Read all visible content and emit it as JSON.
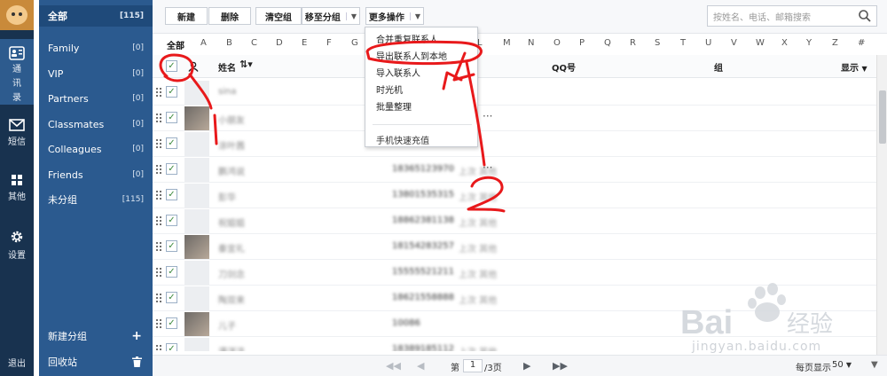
{
  "rail": {
    "contacts_label": "通讯录",
    "sms_label": "短信",
    "other_label": "其他",
    "settings_label": "设置",
    "logout_label": "退出"
  },
  "groups": {
    "items": [
      {
        "label": "全部",
        "count": "[115]"
      },
      {
        "label": "Family",
        "count": "[0]"
      },
      {
        "label": "VIP",
        "count": "[0]"
      },
      {
        "label": "Partners",
        "count": "[0]"
      },
      {
        "label": "Classmates",
        "count": "[0]"
      },
      {
        "label": "Colleagues",
        "count": "[0]"
      },
      {
        "label": "Friends",
        "count": "[0]"
      },
      {
        "label": "未分组",
        "count": "[115]"
      }
    ],
    "new_group_label": "新建分组",
    "recycle_label": "回收站"
  },
  "toolbar": {
    "new_label": "新建",
    "delete_label": "删除",
    "clear_group_label": "清空组",
    "move_group_label": "移至分组",
    "more_label": "更多操作",
    "search_placeholder": "按姓名、电话、邮箱搜索"
  },
  "alphabet": [
    "全部",
    "A",
    "B",
    "C",
    "D",
    "E",
    "F",
    "G",
    "H",
    "I",
    "J",
    "K",
    "L",
    "M",
    "N",
    "O",
    "P",
    "Q",
    "R",
    "S",
    "T",
    "U",
    "V",
    "W",
    "X",
    "Y",
    "Z",
    "#"
  ],
  "table": {
    "col_name": "姓名",
    "col_qq": "QQ号",
    "col_group": "组",
    "col_display": "显示",
    "rows": [
      {
        "name": "sina",
        "phone": "",
        "qq": "",
        "pic": false,
        "dots": false
      },
      {
        "name": "小朋友",
        "phone": "",
        "qq": "",
        "pic": true,
        "dots": true
      },
      {
        "name": "涂叶茜",
        "phone": "",
        "qq": "",
        "pic": false,
        "dots": false
      },
      {
        "name": "鹏鸿说",
        "phone": "18365123970",
        "qq": "上次 其他",
        "pic": false,
        "dots": true
      },
      {
        "name": "彭华",
        "phone": "13801535315",
        "qq": "上次 其他",
        "pic": false,
        "dots": false
      },
      {
        "name": "祝姐姐",
        "phone": "18862381138",
        "qq": "上次 其他",
        "pic": false,
        "dots": false
      },
      {
        "name": "秦宜礼",
        "phone": "18154283257",
        "qq": "上次 其他",
        "pic": true,
        "dots": false
      },
      {
        "name": "刀剑念",
        "phone": "15555521211",
        "qq": "上次 其他",
        "pic": false,
        "dots": false
      },
      {
        "name": "陶双来",
        "phone": "18621558888",
        "qq": "上次 其他",
        "pic": false,
        "dots": false
      },
      {
        "name": "儿子",
        "phone": "10086",
        "qq": "",
        "pic": true,
        "dots": false
      },
      {
        "name": "漫洋洁",
        "phone": "18389185112",
        "qq": "上次 其他",
        "pic": false,
        "dots": false
      }
    ]
  },
  "menu": {
    "items": [
      "合并重复联系人",
      "导出联系人到本地",
      "导入联系人",
      "时光机",
      "批量整理"
    ],
    "recharge": "手机快速充值"
  },
  "pager": {
    "page_prefix": "第",
    "page_value": "1",
    "page_suffix": "/3页",
    "per_page_label": "每页显示",
    "per_page_value": "50"
  },
  "annotation": {
    "mark1": "1",
    "mark2": "2"
  },
  "watermark": {
    "site": "jingyan.baidu.com",
    "brand": "Bai",
    "brand2": "经验"
  },
  "colors": {
    "rail": "#18324f",
    "sidebar": "#2b5a8f",
    "annotation": "#e8191b"
  }
}
